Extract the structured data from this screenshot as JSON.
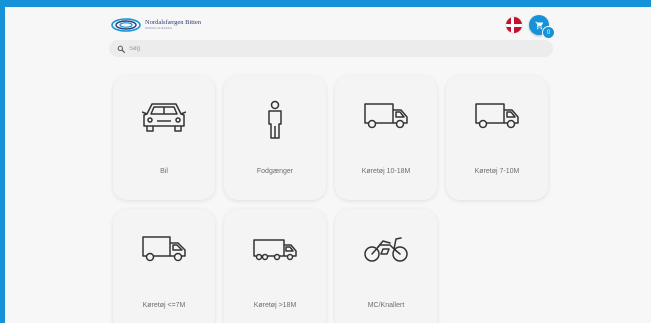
{
  "header": {
    "logo_name": "Nordalsfærgen Bitten",
    "logo_sub": "NORDALSFÆRGEN",
    "cart_count": "0"
  },
  "search": {
    "placeholder": "Søg"
  },
  "categories": [
    {
      "label": "Bil",
      "icon": "car-icon"
    },
    {
      "label": "Fodgænger",
      "icon": "pedestrian-icon"
    },
    {
      "label": "Køretøj 10-18M",
      "icon": "truck-icon"
    },
    {
      "label": "Køretøj 7-10M",
      "icon": "truck-icon"
    },
    {
      "label": "Køretøj <=7M",
      "icon": "van-icon"
    },
    {
      "label": "Køretøj >18M",
      "icon": "lorry-icon"
    },
    {
      "label": "MC/Knallert",
      "icon": "motorcycle-icon"
    }
  ]
}
